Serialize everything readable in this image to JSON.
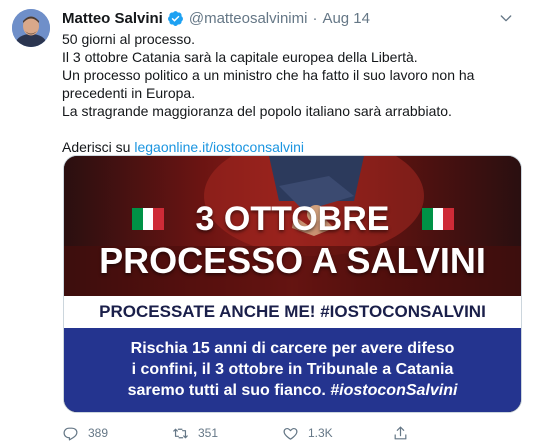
{
  "author": {
    "name": "Matteo Salvini",
    "handle": "@matteosalvinimi",
    "separator": "·",
    "date": "Aug 14"
  },
  "tweet": {
    "lines": [
      "50 giorni al processo.",
      "Il 3 ottobre Catania sarà la capitale europea della Libertà.",
      "Un processo politico a un ministro che ha fatto il suo lavoro non ha",
      "precedenti in Europa.",
      "La stragrande maggioranza del popolo italiano sarà arrabbiato."
    ],
    "cta_prefix": "Aderisci su ",
    "link": "legaonline.it/iostoconsalvini"
  },
  "media": {
    "headline_1": "3 OTTOBRE",
    "headline_2": "PROCESSO A SALVINI",
    "banner": "PROCESSATE ANCHE ME! #IOSTOCONSALVINI",
    "body_lines": [
      "Rischia 15 anni di carcere per avere difeso",
      "i confini, il 3 ottobre in Tribunale a Catania",
      "saremo tutti al suo fianco."
    ],
    "hashtag": "#iostoconSalvini"
  },
  "actions": {
    "replies": "389",
    "retweets": "351",
    "likes": "1.3K"
  },
  "colors": {
    "link": "#1b95e0",
    "verified": "#1da1f2",
    "muted": "#657786",
    "panel_blue": "#24348f",
    "flag_green": "#009246",
    "flag_white": "#ffffff",
    "flag_red": "#ce2b37"
  },
  "icons": [
    "verified-badge-icon",
    "caret-down-icon",
    "reply-icon",
    "retweet-icon",
    "like-icon",
    "share-icon"
  ]
}
